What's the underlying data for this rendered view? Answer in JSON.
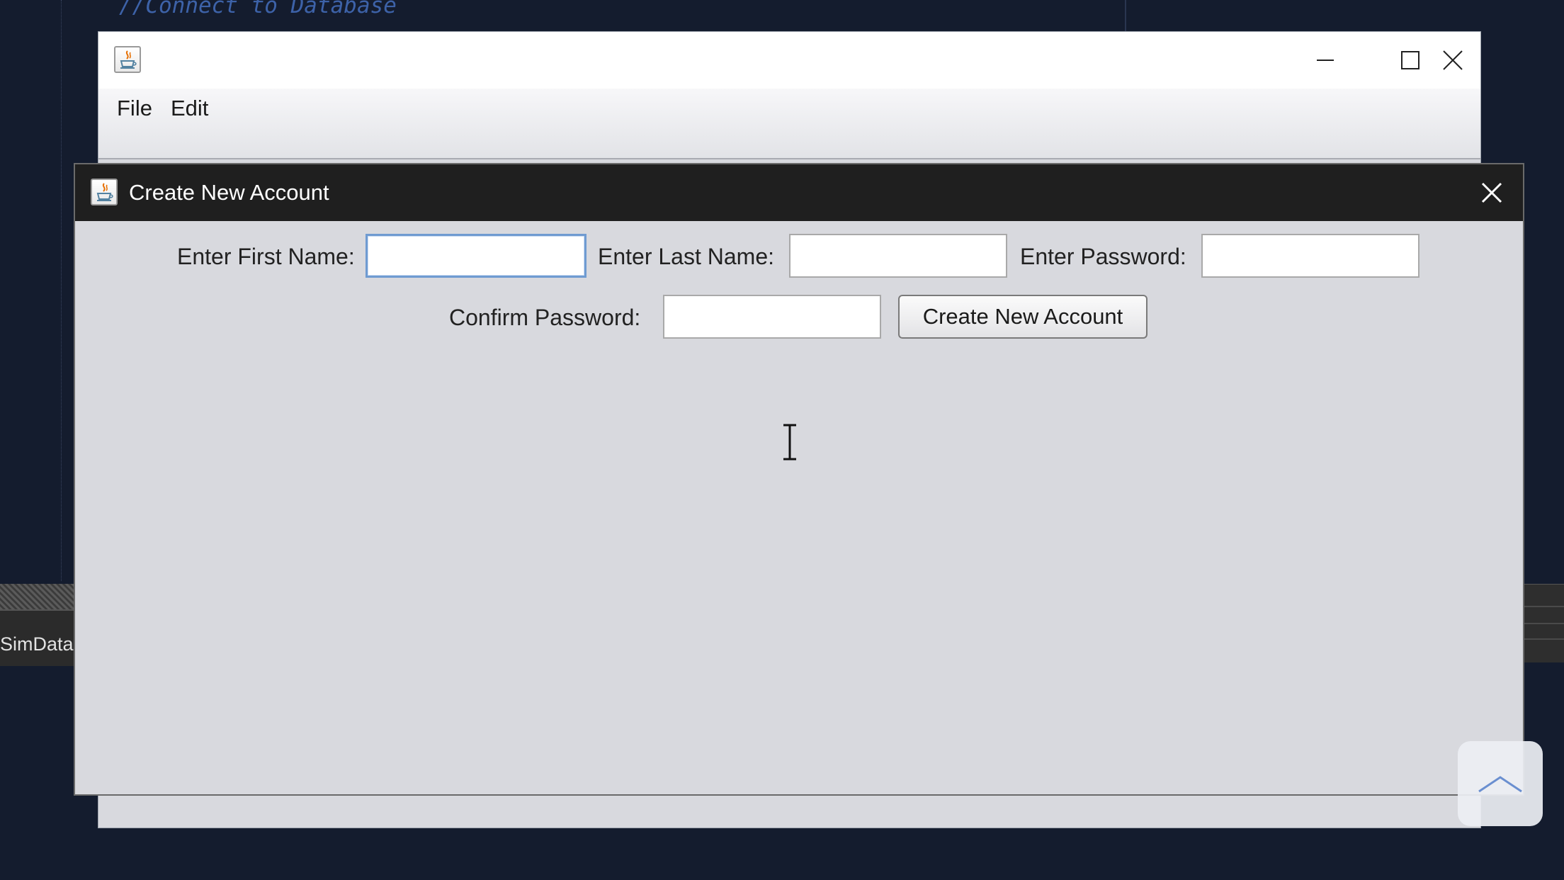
{
  "background": {
    "code_comment": "//Connect to Database",
    "bottom_tab_label": "SimData"
  },
  "main_window": {
    "menu": [
      {
        "label": "File"
      },
      {
        "label": "Edit"
      }
    ],
    "icons": {
      "app": "java-coffee-cup-icon",
      "minimize": "minimize-icon",
      "maximize": "maximize-icon",
      "close": "close-icon"
    }
  },
  "dialog": {
    "title": "Create New Account",
    "first_name": {
      "label": "Enter First Name:",
      "value": ""
    },
    "last_name": {
      "label": "Enter Last Name:",
      "value": ""
    },
    "password": {
      "label": "Enter Password:",
      "value": ""
    },
    "confirm_password": {
      "label": "Confirm Password:",
      "value": ""
    },
    "submit_label": "Create New Account",
    "icons": {
      "app": "java-coffee-cup-icon",
      "close": "close-icon"
    }
  },
  "overlay": {
    "scroll_icon": "chevron-up-icon"
  },
  "colors": {
    "dialog_title_bg": "#1f1f1f",
    "window_bg": "#d8d9de",
    "focus_border": "#6f9bd1",
    "code_bg": "#141c2e"
  }
}
